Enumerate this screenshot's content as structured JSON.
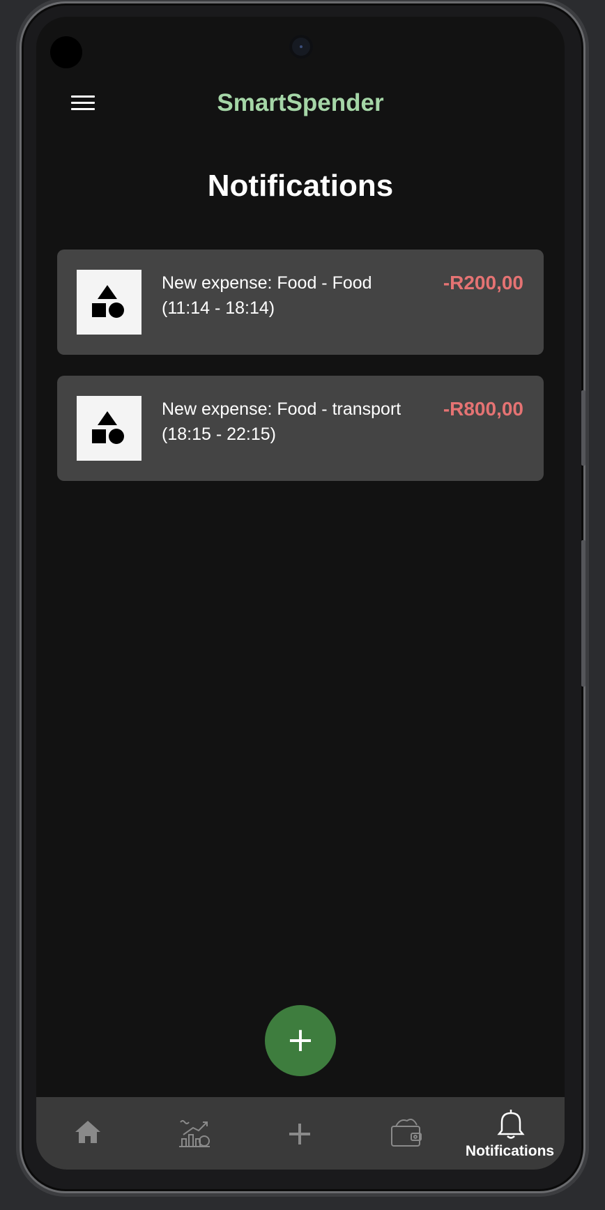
{
  "app": {
    "title": "SmartSpender",
    "page_title": "Notifications",
    "accent_color": "#a5d6a7",
    "expense_color": "#e57373",
    "fab_color": "#3e7d3e"
  },
  "header": {
    "menu_icon": "hamburger-menu-icon"
  },
  "notifications": [
    {
      "icon": "shapes-icon",
      "text": "New expense: Food - Food (11:14 - 18:14)",
      "amount": "-R200,00"
    },
    {
      "icon": "shapes-icon",
      "text": "New expense: Food - transport (18:15 - 22:15)",
      "amount": "-R800,00"
    }
  ],
  "fab": {
    "label": "+",
    "icon": "plus-icon"
  },
  "bottom_nav": {
    "items": [
      {
        "icon": "home-icon",
        "label": "",
        "active": false
      },
      {
        "icon": "statistics-icon",
        "label": "",
        "active": false
      },
      {
        "icon": "plus-icon",
        "label": "",
        "active": false
      },
      {
        "icon": "wallet-icon",
        "label": "",
        "active": false
      },
      {
        "icon": "bell-icon",
        "label": "Notifications",
        "active": true
      }
    ]
  }
}
